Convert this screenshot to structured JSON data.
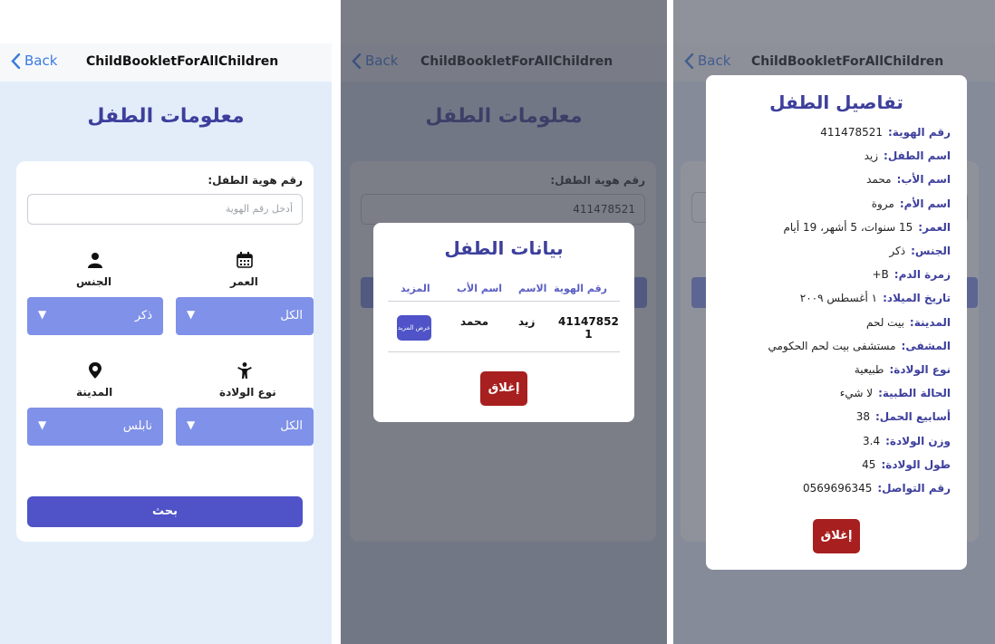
{
  "nav": {
    "back_label": "Back",
    "app_title": "ChildBookletForAllChildren"
  },
  "search_screen": {
    "page_title": "معلومات الطفل",
    "id_label": "رقم هوية الطفل:",
    "id_placeholder": "أدخل رقم الهوية",
    "id_value": "411478521",
    "gender_label": "الجنس",
    "age_label": "العمر",
    "city_label": "المدينة",
    "birth_type_label": "نوع الولادة",
    "gender_value": "ذكر",
    "age_value": "الكل",
    "city_value": "نابلس",
    "birth_type_value": "الكل",
    "dropdown_arrow": "▼",
    "search_button": "بحث"
  },
  "results_modal": {
    "title": "بيانات الطفل",
    "columns": {
      "id": "رقم الهوية",
      "name": "الاسم",
      "father": "اسم الأب",
      "more": "المزيد"
    },
    "row": {
      "id_line1": "41147852",
      "id_line2": "1",
      "name": "زيد",
      "father": "محمد",
      "more_button": "عرض المزيد"
    },
    "close_button": "إغلاق"
  },
  "details_modal": {
    "title": "تفاصيل الطفل",
    "rows": [
      {
        "label": "رقم الهوية:",
        "value": "411478521"
      },
      {
        "label": "اسم الطفل:",
        "value": "زيد"
      },
      {
        "label": "اسم الأب:",
        "value": "محمد"
      },
      {
        "label": "اسم الأم:",
        "value": "مروة"
      },
      {
        "label": "العمر:",
        "value": "15 سنوات، 5 أشهر، 19 أيام"
      },
      {
        "label": "الجنس:",
        "value": "ذكر"
      },
      {
        "label": "زمرة الدم:",
        "value": "B+"
      },
      {
        "label": "تاريخ الميلاد:",
        "value": "١ أغسطس ٢٠٠٩"
      },
      {
        "label": "المدينة:",
        "value": "بيت لحم"
      },
      {
        "label": "المشفى:",
        "value": "مستشفى بيت لحم الحكومي"
      },
      {
        "label": "نوع الولادة:",
        "value": "طبيعية"
      },
      {
        "label": "الحالة الطبية:",
        "value": "لا شيء"
      },
      {
        "label": "أسابيع الحمل:",
        "value": "38"
      },
      {
        "label": "وزن الولادة:",
        "value": "3.4"
      },
      {
        "label": "طول الولادة:",
        "value": "45"
      },
      {
        "label": "رقم التواصل:",
        "value": "0569696345"
      }
    ],
    "close_button": "إغلاق"
  },
  "colors": {
    "accent": "#4f53c7",
    "title": "#3d3f9c",
    "select": "#7f91e8",
    "danger": "#a81f1f",
    "background": "#e3edfa"
  },
  "icons": {
    "back": "chevron-left-icon",
    "gender": "person-icon",
    "age": "calendar-icon",
    "city": "location-pin-icon",
    "birth_type": "child-icon"
  }
}
